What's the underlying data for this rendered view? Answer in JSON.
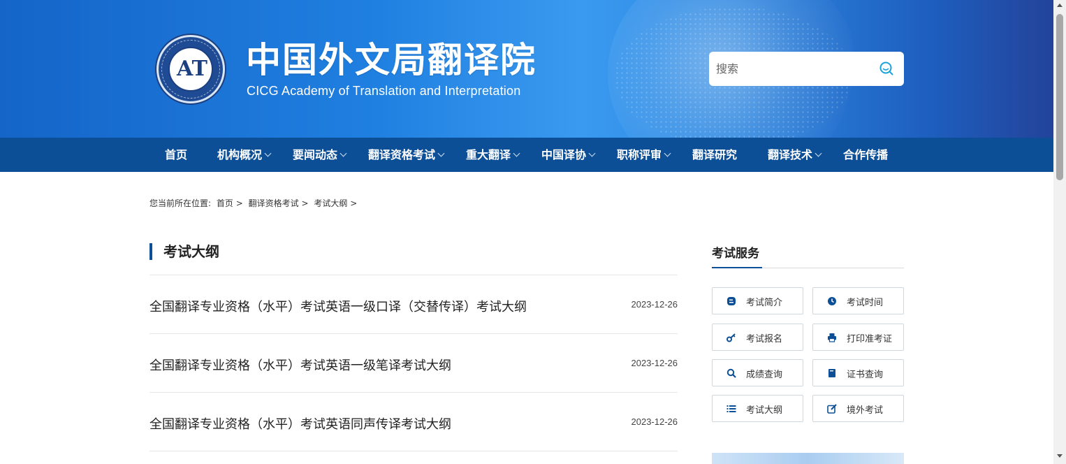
{
  "header": {
    "title": "中国外文局翻译院",
    "subtitle": "CICG Academy of Translation and Interpretation",
    "logo_text": "AT",
    "search": {
      "placeholder": "搜索",
      "icon": "search-icon"
    }
  },
  "nav": {
    "items": [
      {
        "label": "首页",
        "has_dropdown": false
      },
      {
        "label": "机构概况",
        "has_dropdown": true
      },
      {
        "label": "要闻动态",
        "has_dropdown": true
      },
      {
        "label": "翻译资格考试",
        "has_dropdown": true
      },
      {
        "label": "重大翻译",
        "has_dropdown": true
      },
      {
        "label": "中国译协",
        "has_dropdown": true
      },
      {
        "label": "职称评审",
        "has_dropdown": true
      },
      {
        "label": "翻译研究",
        "has_dropdown": false
      },
      {
        "label": "翻译技术",
        "has_dropdown": true
      },
      {
        "label": "合作传播",
        "has_dropdown": false
      }
    ]
  },
  "breadcrumb": {
    "prefix": "您当前所在位置:",
    "items": [
      "首页",
      "翻译资格考试",
      "考试大纲"
    ],
    "separator": ">"
  },
  "main": {
    "section_title": "考试大纲",
    "articles": [
      {
        "title": "全国翻译专业资格（水平）考试英语一级口译（交替传译）考试大纲",
        "date": "2023-12-26"
      },
      {
        "title": "全国翻译专业资格（水平）考试英语一级笔译考试大纲",
        "date": "2023-12-26"
      },
      {
        "title": "全国翻译专业资格（水平）考试英语同声传译考试大纲",
        "date": "2023-12-26"
      }
    ]
  },
  "sidebar": {
    "title": "考试服务",
    "services": [
      {
        "label": "考试简介",
        "icon": "blog-icon"
      },
      {
        "label": "考试时间",
        "icon": "clock-icon"
      },
      {
        "label": "考试报名",
        "icon": "key-icon"
      },
      {
        "label": "打印准考证",
        "icon": "printer-icon"
      },
      {
        "label": "成绩查询",
        "icon": "search-icon"
      },
      {
        "label": "证书查询",
        "icon": "book-icon"
      },
      {
        "label": "考试大纲",
        "icon": "list-icon"
      },
      {
        "label": "境外考试",
        "icon": "edit-icon"
      }
    ]
  },
  "colors": {
    "nav_bg": "#0d4f96",
    "accent": "#0d4f96",
    "header_blue": "#1f7fe0",
    "search_icon": "#1aa3d9"
  }
}
